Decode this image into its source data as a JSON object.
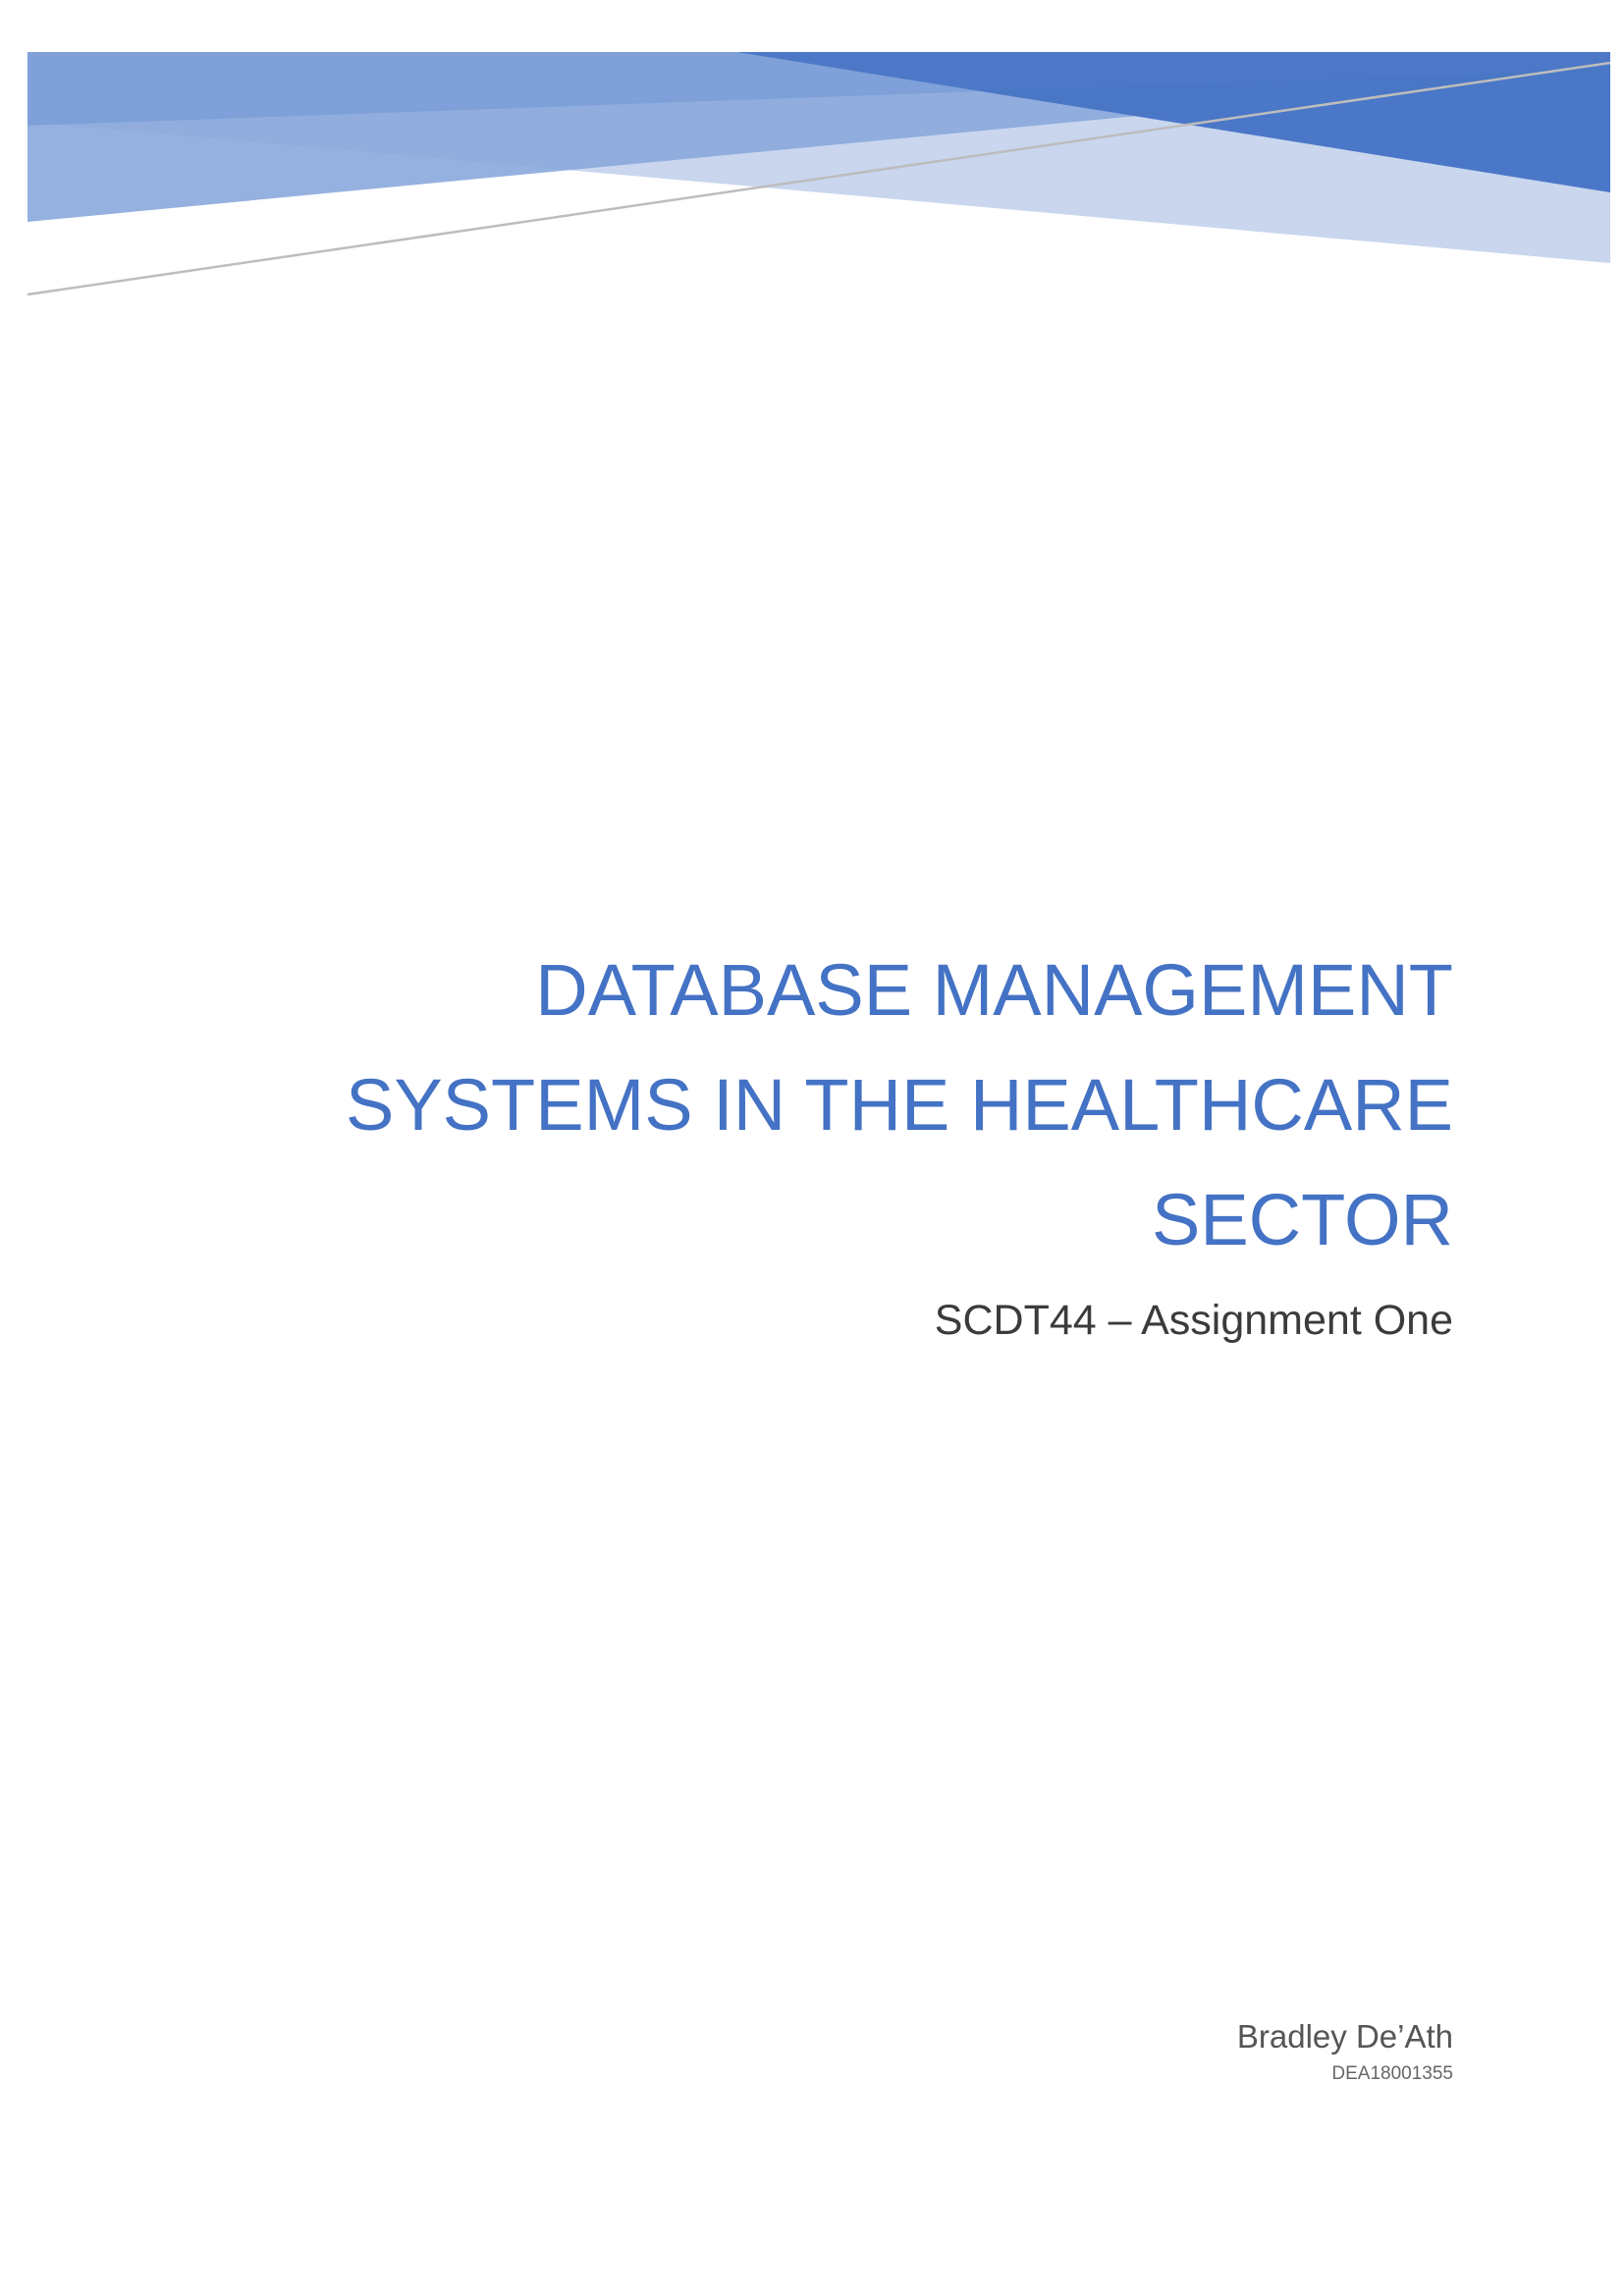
{
  "document": {
    "title": "Database Management Systems in the Healthcare Sector",
    "subtitle": "SCDT44 – Assignment One",
    "author": "Bradley De’Ath",
    "student_id": "DEA18001355"
  },
  "colors": {
    "accent": "#4472c4",
    "accent_light": "#7f9fd6",
    "accent_pale": "#c9d6ee",
    "subtitle_text": "#3b3b3b",
    "author_text": "#555555"
  }
}
